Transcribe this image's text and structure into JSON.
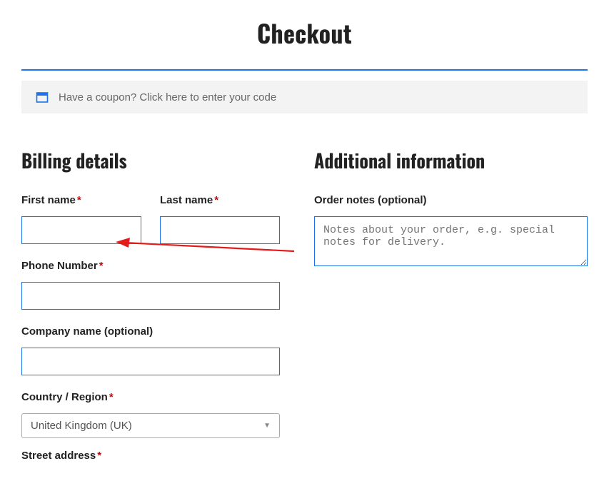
{
  "page": {
    "title": "Checkout"
  },
  "coupon": {
    "text": "Have a coupon? Click here to enter your code"
  },
  "billing": {
    "heading": "Billing details",
    "fields": {
      "first_name": {
        "label": "First name",
        "value": "",
        "required": true
      },
      "last_name": {
        "label": "Last name",
        "value": "",
        "required": true
      },
      "phone": {
        "label": "Phone Number",
        "value": "",
        "required": true
      },
      "company": {
        "label": "Company name (optional)",
        "value": "",
        "required": false
      },
      "country": {
        "label": "Country / Region",
        "value": "United Kingdom (UK)",
        "required": true
      },
      "street": {
        "label": "Street address",
        "required": true
      }
    }
  },
  "additional": {
    "heading": "Additional information",
    "order_notes": {
      "label": "Order notes (optional)",
      "placeholder": "Notes about your order, e.g. special notes for delivery.",
      "value": ""
    }
  },
  "required_mark": "*",
  "colors": {
    "accent": "#1e73e8",
    "required": "#d40000",
    "arrow": "#e31b1b"
  }
}
